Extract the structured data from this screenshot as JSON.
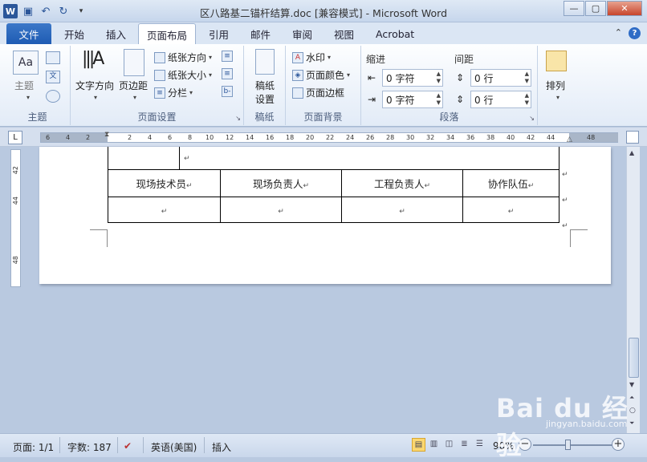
{
  "window": {
    "title": "区八路基二锚杆结算.doc [兼容模式] - Microsoft Word",
    "app_icon": "W"
  },
  "tabs": {
    "file": "文件",
    "items": [
      "开始",
      "插入",
      "页面布局",
      "引用",
      "邮件",
      "审阅",
      "视图",
      "Acrobat"
    ],
    "active": "页面布局"
  },
  "ribbon": {
    "theme_group": {
      "label": "主题",
      "theme_button": "主题"
    },
    "page_setup": {
      "label": "页面设置",
      "text_direction": "文字方向",
      "margins": "页边距",
      "orientation": "纸张方向",
      "size": "纸张大小",
      "columns": "分栏"
    },
    "draft": {
      "label": "稿纸",
      "button": "稿纸\n设置",
      "button_line1": "稿纸",
      "button_line2": "设置"
    },
    "page_background": {
      "label": "页面背景",
      "watermark": "水印",
      "page_color": "页面颜色",
      "page_border": "页面边框"
    },
    "paragraph": {
      "label": "段落",
      "indent_label": "缩进",
      "spacing_label": "间距",
      "indent_left": "0 字符",
      "indent_right": "0 字符",
      "spacing_before": "0 行",
      "spacing_after": "0 行"
    },
    "arrange": {
      "label": "排列"
    }
  },
  "ruler": {
    "ticks": [
      "6",
      "4",
      "2",
      "",
      "2",
      "4",
      "6",
      "8",
      "10",
      "12",
      "14",
      "16",
      "18",
      "20",
      "22",
      "24",
      "26",
      "28",
      "30",
      "32",
      "34",
      "36",
      "38",
      "40",
      "42",
      "44",
      "",
      "48"
    ],
    "vticks": [
      "42",
      "44",
      "48"
    ]
  },
  "document": {
    "table_headers": [
      "现场技术员",
      "现场负责人",
      "工程负责人",
      "协作队伍"
    ],
    "para_mark": "↵"
  },
  "statusbar": {
    "page": "页面: 1/1",
    "words": "字数: 187",
    "language": "英语(美国)",
    "insert_mode": "插入",
    "zoom": "90%"
  },
  "watermark": {
    "text": "Bai du 经验",
    "sub": "jingyan.baidu.com"
  }
}
